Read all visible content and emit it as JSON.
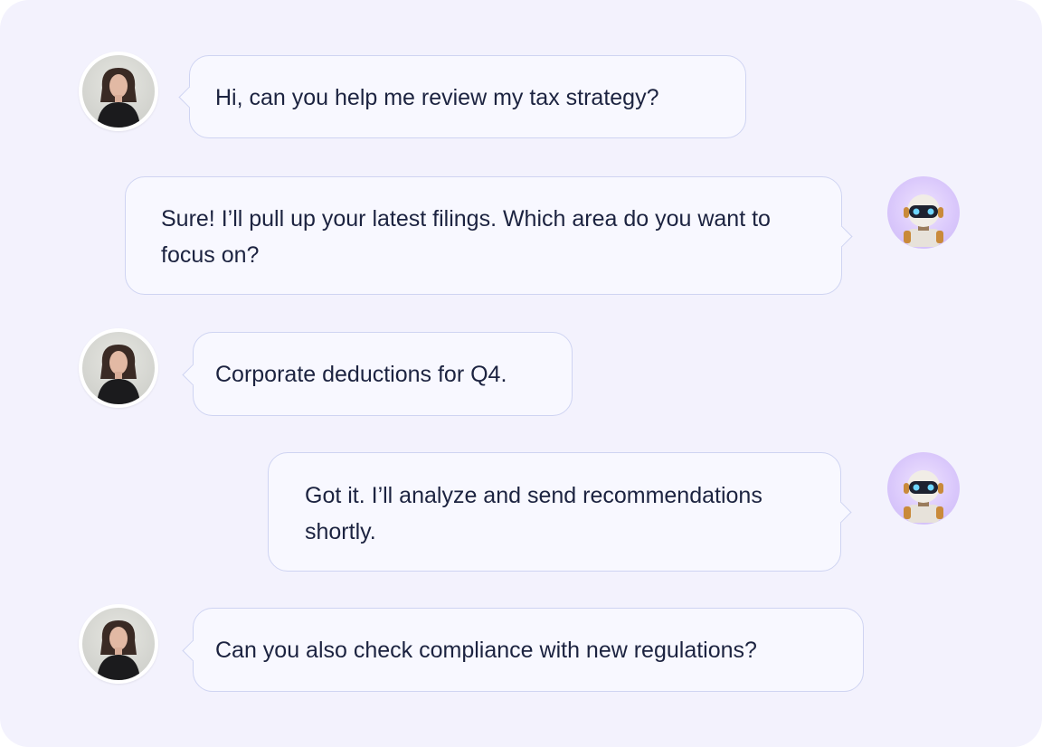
{
  "conversation": {
    "messages": [
      {
        "sender": "user",
        "text": "Hi, can you help me review my tax strategy?"
      },
      {
        "sender": "bot",
        "text": "Sure! I’ll pull up your latest filings. Which area do you want to focus on?"
      },
      {
        "sender": "user",
        "text": "Corporate deductions for Q4."
      },
      {
        "sender": "bot",
        "text": "Got it. I’ll analyze and send recommendations shortly."
      },
      {
        "sender": "user",
        "text": "Can you also check compliance with new regulations?"
      }
    ]
  },
  "colors": {
    "panel_bg": "#f3f2fd",
    "bubble_bg": "#f8f8ff",
    "bubble_border": "#cfd4f2",
    "text": "#1c2340",
    "bot_avatar_bg": "#d9c7fb"
  },
  "icons": {
    "user_avatar": "user-avatar-photo",
    "bot_avatar": "robot-avatar"
  }
}
